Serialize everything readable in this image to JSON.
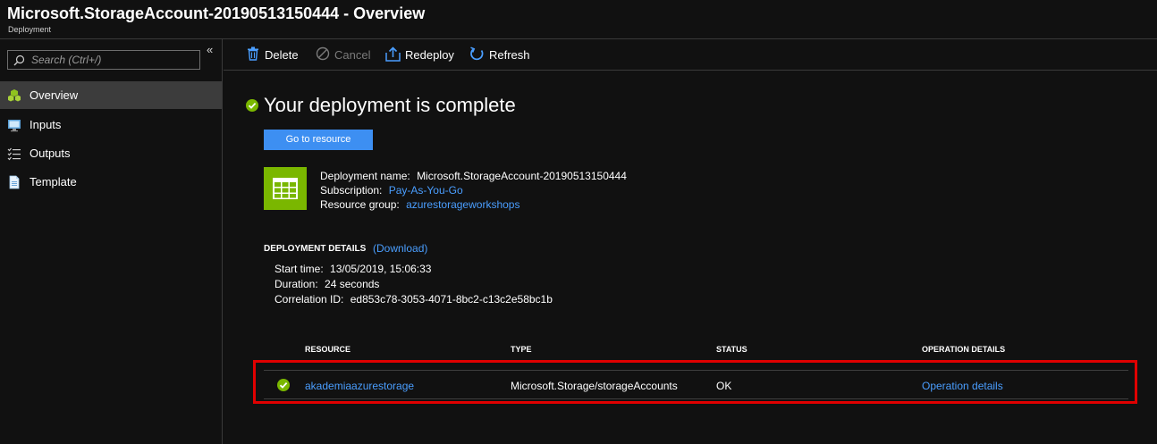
{
  "header": {
    "title": "Microsoft.StorageAccount-20190513150444 - Overview",
    "subtitle": "Deployment"
  },
  "sidebar": {
    "search_placeholder": "Search (Ctrl+/)",
    "collapse_label": "«",
    "items": [
      {
        "label": "Overview",
        "icon": "overview-cubes-icon",
        "active": true
      },
      {
        "label": "Inputs",
        "icon": "inputs-monitor-icon",
        "active": false
      },
      {
        "label": "Outputs",
        "icon": "outputs-list-icon",
        "active": false
      },
      {
        "label": "Template",
        "icon": "template-document-icon",
        "active": false
      }
    ]
  },
  "toolbar": {
    "delete_label": "Delete",
    "cancel_label": "Cancel",
    "redeploy_label": "Redeploy",
    "refresh_label": "Refresh"
  },
  "main": {
    "headline": "Your deployment is complete",
    "go_to_resource_label": "Go to resource",
    "deployment_name_label": "Deployment name:",
    "deployment_name_value": "Microsoft.StorageAccount-20190513150444",
    "subscription_label": "Subscription:",
    "subscription_value": "Pay-As-You-Go",
    "resource_group_label": "Resource group:",
    "resource_group_value": "azurestorageworkshops",
    "details_heading": "DEPLOYMENT DETAILS",
    "download_label": "(Download)",
    "start_time_label": "Start time:",
    "start_time_value": "13/05/2019, 15:06:33",
    "duration_label": "Duration:",
    "duration_value": "24 seconds",
    "correlation_label": "Correlation ID:",
    "correlation_value": "ed853c78-3053-4071-8bc2-c13c2e58bc1b"
  },
  "table": {
    "columns": [
      "RESOURCE",
      "TYPE",
      "STATUS",
      "OPERATION DETAILS"
    ],
    "rows": [
      {
        "resource": "akademiaazurestorage",
        "type": "Microsoft.Storage/storageAccounts",
        "status": "OK",
        "operation": "Operation details"
      }
    ]
  },
  "colors": {
    "background": "#111111",
    "accent_blue": "#3d8ff2",
    "link_blue": "#4a9eff",
    "success_green": "#7ab700",
    "highlight_red": "#e00000",
    "active_nav": "#3c3c3c"
  }
}
